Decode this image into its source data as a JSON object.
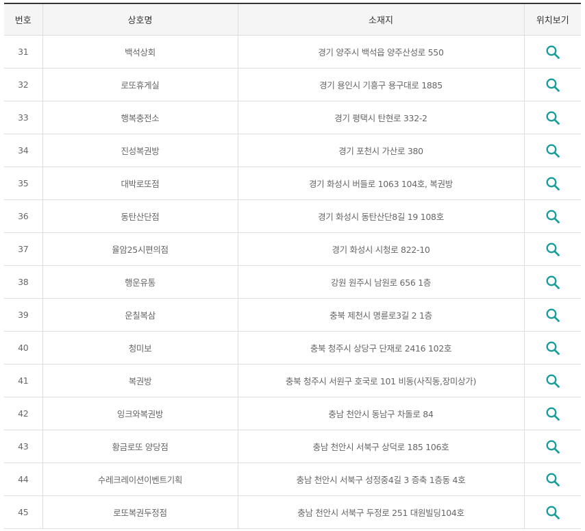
{
  "accent_color": "#1a9e9a",
  "headers": {
    "number": "번호",
    "store_name": "상호명",
    "address": "소재지",
    "location": "위치보기"
  },
  "rows": [
    {
      "number": "31",
      "store_name": "백석상회",
      "address": "경기 양주시 백석읍 양주산성로 550",
      "icon": "search-icon"
    },
    {
      "number": "32",
      "store_name": "로또휴게실",
      "address": "경기 용인시 기흥구 용구대로 1885",
      "icon": "search-icon"
    },
    {
      "number": "33",
      "store_name": "행복충전소",
      "address": "경기 평택시 탄현로 332-2",
      "icon": "search-icon"
    },
    {
      "number": "34",
      "store_name": "진성복권방",
      "address": "경기 포천시 가산로 380",
      "icon": "search-icon"
    },
    {
      "number": "35",
      "store_name": "대박로또점",
      "address": "경기 화성시 버들로 1063 104호, 복권방",
      "icon": "search-icon"
    },
    {
      "number": "36",
      "store_name": "동탄산단점",
      "address": "경기 화성시 동탄산단8길 19 108호",
      "icon": "search-icon"
    },
    {
      "number": "37",
      "store_name": "율암25시편의점",
      "address": "경기 화성시 시청로 822-10",
      "icon": "search-icon"
    },
    {
      "number": "38",
      "store_name": "행운유통",
      "address": "강원 원주시 남원로 656 1층",
      "icon": "search-icon"
    },
    {
      "number": "39",
      "store_name": "운칠복삼",
      "address": "충북 제천시 명륜로3길 2 1층",
      "icon": "search-icon"
    },
    {
      "number": "40",
      "store_name": "청미보",
      "address": "충북 청주시 상당구 단재로 2416 102호",
      "icon": "search-icon"
    },
    {
      "number": "41",
      "store_name": "복권방",
      "address": "충북 청주시 서원구 호국로 101 비동(사직동,장미상가)",
      "icon": "search-icon"
    },
    {
      "number": "42",
      "store_name": "잉크와복권방",
      "address": "충남 천안시 동남구 차돌로 84",
      "icon": "search-icon"
    },
    {
      "number": "43",
      "store_name": "황금로또 양당점",
      "address": "충남 천안시 서북구 상덕로 185 106호",
      "icon": "search-icon"
    },
    {
      "number": "44",
      "store_name": "수레크레이션이벤트기획",
      "address": "충남 천안시 서북구 성정중4길 3 증축 1층동 4호",
      "icon": "search-icon"
    },
    {
      "number": "45",
      "store_name": "로또복권두정점",
      "address": "충남 천안시 서북구 두정로 251 대원빌딩104호",
      "icon": "search-icon"
    }
  ]
}
